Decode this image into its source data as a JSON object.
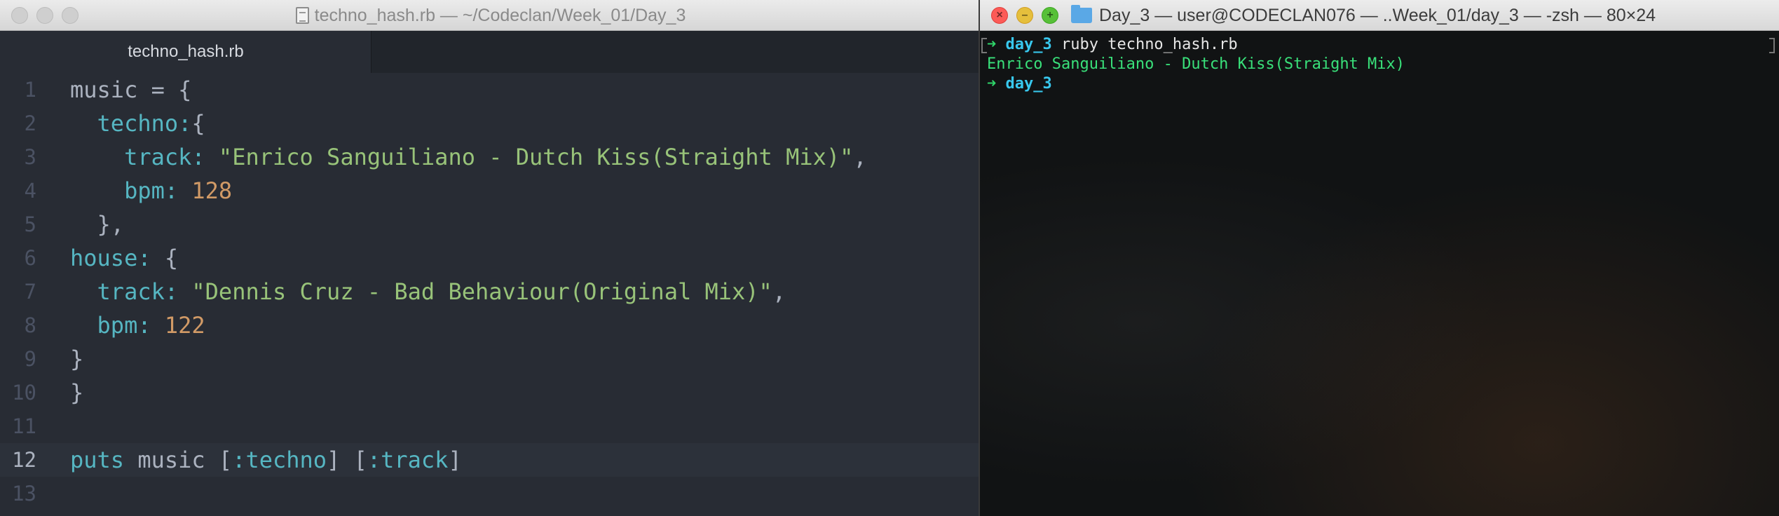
{
  "editor": {
    "window_title": "techno_hash.rb — ~/Codeclan/Week_01/Day_3",
    "tab_label": "techno_hash.rb",
    "current_line": 12,
    "lines": [
      {
        "number": "1",
        "tokens": [
          {
            "t": "music = {",
            "c": "plain"
          }
        ]
      },
      {
        "number": "2",
        "tokens": [
          {
            "t": "  ",
            "c": "plain"
          },
          {
            "t": "techno:",
            "c": "key"
          },
          {
            "t": "{",
            "c": "plain"
          }
        ]
      },
      {
        "number": "3",
        "tokens": [
          {
            "t": "    ",
            "c": "plain"
          },
          {
            "t": "track:",
            "c": "key"
          },
          {
            "t": " ",
            "c": "plain"
          },
          {
            "t": "\"Enrico Sanguiliano - Dutch Kiss(Straight Mix)\"",
            "c": "str"
          },
          {
            "t": ",",
            "c": "plain"
          }
        ]
      },
      {
        "number": "4",
        "tokens": [
          {
            "t": "    ",
            "c": "plain"
          },
          {
            "t": "bpm:",
            "c": "key"
          },
          {
            "t": " ",
            "c": "plain"
          },
          {
            "t": "128",
            "c": "num"
          }
        ]
      },
      {
        "number": "5",
        "tokens": [
          {
            "t": "  },",
            "c": "plain"
          }
        ]
      },
      {
        "number": "6",
        "tokens": [
          {
            "t": "house:",
            "c": "key"
          },
          {
            "t": " {",
            "c": "plain"
          }
        ]
      },
      {
        "number": "7",
        "tokens": [
          {
            "t": "  ",
            "c": "plain"
          },
          {
            "t": "track:",
            "c": "key"
          },
          {
            "t": " ",
            "c": "plain"
          },
          {
            "t": "\"Dennis Cruz - Bad Behaviour(Original Mix)\"",
            "c": "str"
          },
          {
            "t": ",",
            "c": "plain"
          }
        ]
      },
      {
        "number": "8",
        "tokens": [
          {
            "t": "  ",
            "c": "plain"
          },
          {
            "t": "bpm:",
            "c": "key"
          },
          {
            "t": " ",
            "c": "plain"
          },
          {
            "t": "122",
            "c": "num"
          }
        ]
      },
      {
        "number": "9",
        "tokens": [
          {
            "t": "}",
            "c": "plain"
          }
        ]
      },
      {
        "number": "10",
        "tokens": [
          {
            "t": "}",
            "c": "plain"
          }
        ]
      },
      {
        "number": "11",
        "tokens": []
      },
      {
        "number": "12",
        "tokens": [
          {
            "t": "puts",
            "c": "key"
          },
          {
            "t": " music [",
            "c": "plain"
          },
          {
            "t": ":techno",
            "c": "key"
          },
          {
            "t": "] [",
            "c": "plain"
          },
          {
            "t": ":track",
            "c": "key"
          },
          {
            "t": "]",
            "c": "plain"
          }
        ]
      },
      {
        "number": "13",
        "tokens": []
      }
    ]
  },
  "terminal": {
    "window_title": "Day_3 — user@CODECLAN076 — ..Week_01/day_3 — -zsh — 80×24",
    "prompt_arrow": "➜",
    "prompt_dir": "day_3",
    "command": "ruby techno_hash.rb",
    "output": "Enrico Sanguiliano - Dutch Kiss(Straight Mix)"
  },
  "colors": {
    "editor_bg": "#282c34",
    "key": "#56b6c2",
    "string": "#98c379",
    "number": "#d19a66",
    "prompt_arrow": "#2fd66a",
    "prompt_dir": "#38c8ee",
    "terminal_output": "#39e07a"
  },
  "icons": {
    "editor_file": "file-icon",
    "terminal_folder": "folder-icon"
  }
}
